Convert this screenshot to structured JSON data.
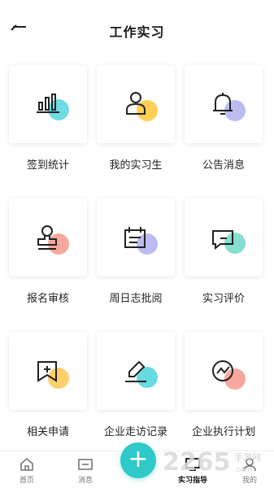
{
  "header": {
    "title": "工作实习",
    "back_icon": "arrow-left-icon"
  },
  "menu": [
    {
      "label": "签到统计",
      "icon": "bar-chart-icon",
      "accent": "#5fd8e0"
    },
    {
      "label": "我的实习生",
      "icon": "person-icon",
      "accent": "#ffcc4d"
    },
    {
      "label": "公告消息",
      "icon": "bell-icon",
      "accent": "#b8b8f2"
    },
    {
      "label": "报名审核",
      "icon": "stamp-icon",
      "accent": "#f7a399"
    },
    {
      "label": "周日志批阅",
      "icon": "calendar-icon",
      "accent": "#b8b8f2"
    },
    {
      "label": "实习评价",
      "icon": "comment-icon",
      "accent": "#7edccc"
    },
    {
      "label": "相关申请",
      "icon": "add-bookmark-icon",
      "accent": "#ffcc66"
    },
    {
      "label": "企业走访记录",
      "icon": "pen-icon",
      "accent": "#5fd8e0"
    },
    {
      "label": "企业执行计划",
      "icon": "trend-chart-icon",
      "accent": "#f7a399"
    }
  ],
  "tabbar": {
    "tabs": [
      {
        "label": "首页",
        "icon": "home-icon"
      },
      {
        "label": "消息",
        "icon": "message-icon"
      },
      {
        "label": "实习指导",
        "icon": "monitor-icon",
        "active": true
      },
      {
        "label": "我的",
        "icon": "user-icon"
      }
    ],
    "fab_icon": "plus-icon",
    "fab_label": "+"
  },
  "watermark": {
    "text": "2265.com",
    "sub": "手游网"
  },
  "colors": {
    "fab": "#2ec9c9",
    "icon_stroke": "#222222"
  }
}
